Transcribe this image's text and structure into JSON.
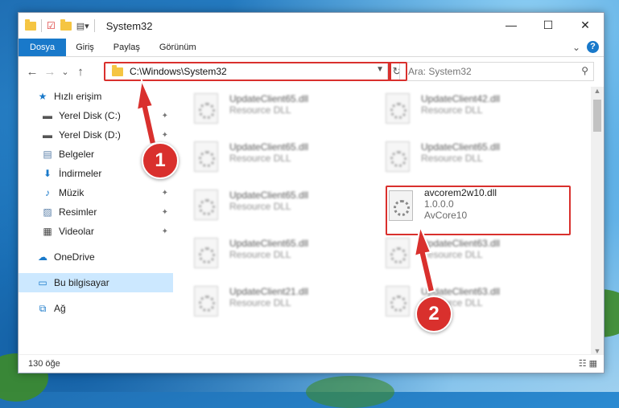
{
  "window": {
    "title": "System32",
    "controls": {
      "minimize": "—",
      "maximize": "☐",
      "close": "✕"
    }
  },
  "ribbon": {
    "tabs": [
      "Dosya",
      "Giriş",
      "Paylaş",
      "Görünüm"
    ],
    "collapse": "⌄",
    "help": "?"
  },
  "address": {
    "path": "C:\\Windows\\System32",
    "refresh": "↻",
    "search_placeholder": "Ara: System32"
  },
  "nav_buttons": {
    "back": "←",
    "forward": "→",
    "recent": "⌄",
    "up": "↑"
  },
  "sidebar": {
    "items": [
      {
        "label": "Hızlı erişim",
        "icon": "star-icon",
        "glyph": "★",
        "pinned": false
      },
      {
        "label": "Yerel Disk (C:)",
        "icon": "drive-icon",
        "glyph": "▬",
        "pinned": true
      },
      {
        "label": "Yerel Disk (D:)",
        "icon": "drive-icon",
        "glyph": "▬",
        "pinned": true
      },
      {
        "label": "Belgeler",
        "icon": "documents-icon",
        "glyph": "▤",
        "pinned": true
      },
      {
        "label": "İndirmeler",
        "icon": "download-icon",
        "glyph": "⬇",
        "pinned": true
      },
      {
        "label": "Müzik",
        "icon": "music-icon",
        "glyph": "♪",
        "pinned": true
      },
      {
        "label": "Resimler",
        "icon": "pictures-icon",
        "glyph": "▨",
        "pinned": true
      },
      {
        "label": "Videolar",
        "icon": "video-icon",
        "glyph": "▦",
        "pinned": true
      },
      {
        "label": "OneDrive",
        "icon": "cloud-icon",
        "glyph": "☁",
        "pinned": false
      },
      {
        "label": "Bu bilgisayar",
        "icon": "computer-icon",
        "glyph": "▭",
        "pinned": false
      },
      {
        "label": "Ağ",
        "icon": "network-icon",
        "glyph": "⧉",
        "pinned": false
      }
    ],
    "pin_glyph": "📌"
  },
  "files": {
    "left": [
      {
        "name": "UpdateClient65.dll",
        "sub": "Resource DLL"
      },
      {
        "name": "UpdateClient65.dll",
        "sub": "Resource DLL"
      },
      {
        "name": "UpdateClient65.dll",
        "sub": "Resource DLL"
      },
      {
        "name": "UpdateClient65.dll",
        "sub": "Resource DLL"
      },
      {
        "name": "UpdateClient21.dll",
        "sub": "Resource DLL"
      }
    ],
    "right": [
      {
        "name": "UpdateClient42.dll",
        "sub": "Resource DLL"
      },
      {
        "name": "UpdateClient65.dll",
        "sub": "Resource DLL"
      },
      {
        "name": "UpdateClient63.dll",
        "sub": "Resource DLL"
      },
      {
        "name": "UpdateClient63.dll",
        "sub": "Resource DLL"
      }
    ],
    "highlight": {
      "name": "avcorem2w10.dll",
      "version": "1.0.0.0",
      "company": "AvCore10"
    }
  },
  "status": {
    "count": "130 öğe",
    "views": "☷ ▦"
  },
  "callouts": [
    "1",
    "2"
  ],
  "colors": {
    "accent": "#1979ca",
    "callout": "#d9302d"
  }
}
